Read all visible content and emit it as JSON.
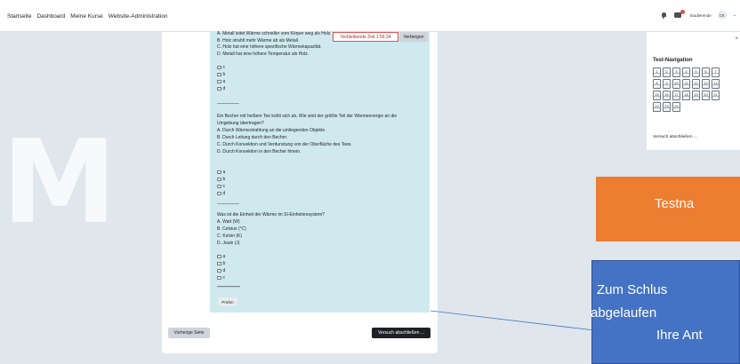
{
  "topnav": {
    "links": [
      "Startseite",
      "Dashboard",
      "Meine Kurse",
      "Website-Administration"
    ],
    "role": "Studierende",
    "avatar": "CK"
  },
  "question_panel": {
    "timer": "Verbleibende Zeit 1:56:34",
    "hide_label": "Verbergen",
    "q1_lines": [
      "A. Metall leitet Wärme schneller vom Körper weg als Holz.",
      "B. Holz strahlt mehr Wärme ab als Metall.",
      "C. Holz hat eine höhere spezifische Wärmekapazität.",
      "D. Metall hat eine höhere Temperatur als Holz."
    ],
    "q1_options": [
      "c",
      "b",
      "a",
      "d"
    ],
    "separator": "------------------",
    "q2_lines": [
      "Ein Becher mit heißem Tee kühlt sich ab. Wie wird der größte Teil der Wärmeenergie an die",
      "Umgebung übertragen?",
      "A. Durch Wärmestrahlung an die umliegenden Objekte.",
      "B. Durch Leitung durch den Becher.",
      "C. Durch Konvektion und Verdunstung von der Oberfläche des Tees.",
      "D. Durch Konvektion in den Becher hinein."
    ],
    "q2_options": [
      "a",
      "b",
      "c",
      "d"
    ],
    "q3_lines": [
      "Was ist die Einheit der Wärme im SI-Einheitensystem?",
      "A. Watt (W)",
      "B. Celsius (°C)",
      "C. Kelvin (K)",
      "D. Joule (J)"
    ],
    "q3_options": [
      "a",
      "b",
      "d",
      "c"
    ],
    "separator_last": "-------------------",
    "check_label": "Prüfen"
  },
  "footer_buttons": {
    "prev": "Vorherige Seite",
    "finish": "Versuch abschließen ..."
  },
  "test_navigation": {
    "title": "Test-Navigation",
    "rows": [
      [
        "1",
        "2",
        "3",
        "4",
        "5",
        "6",
        "7"
      ],
      [
        "8",
        "9",
        "10",
        "11",
        "12",
        "13",
        "14"
      ],
      [
        "15",
        "16",
        "17",
        "18",
        "19",
        "20",
        "21"
      ],
      [
        "22",
        "23",
        "24"
      ]
    ],
    "finish_link": "Versuch abschließen ..."
  },
  "callouts": {
    "orange": "Testna",
    "blue_line1": "Zum Schlus",
    "blue_line2": "abgelaufen",
    "blue_line3": "Ihre Ant"
  },
  "background": {
    "letter": "M"
  },
  "colors": {
    "question_bg": "#cfe9ef",
    "orange": "#ed7d31",
    "blue": "#4472c4",
    "timer_border": "#d9534f"
  }
}
